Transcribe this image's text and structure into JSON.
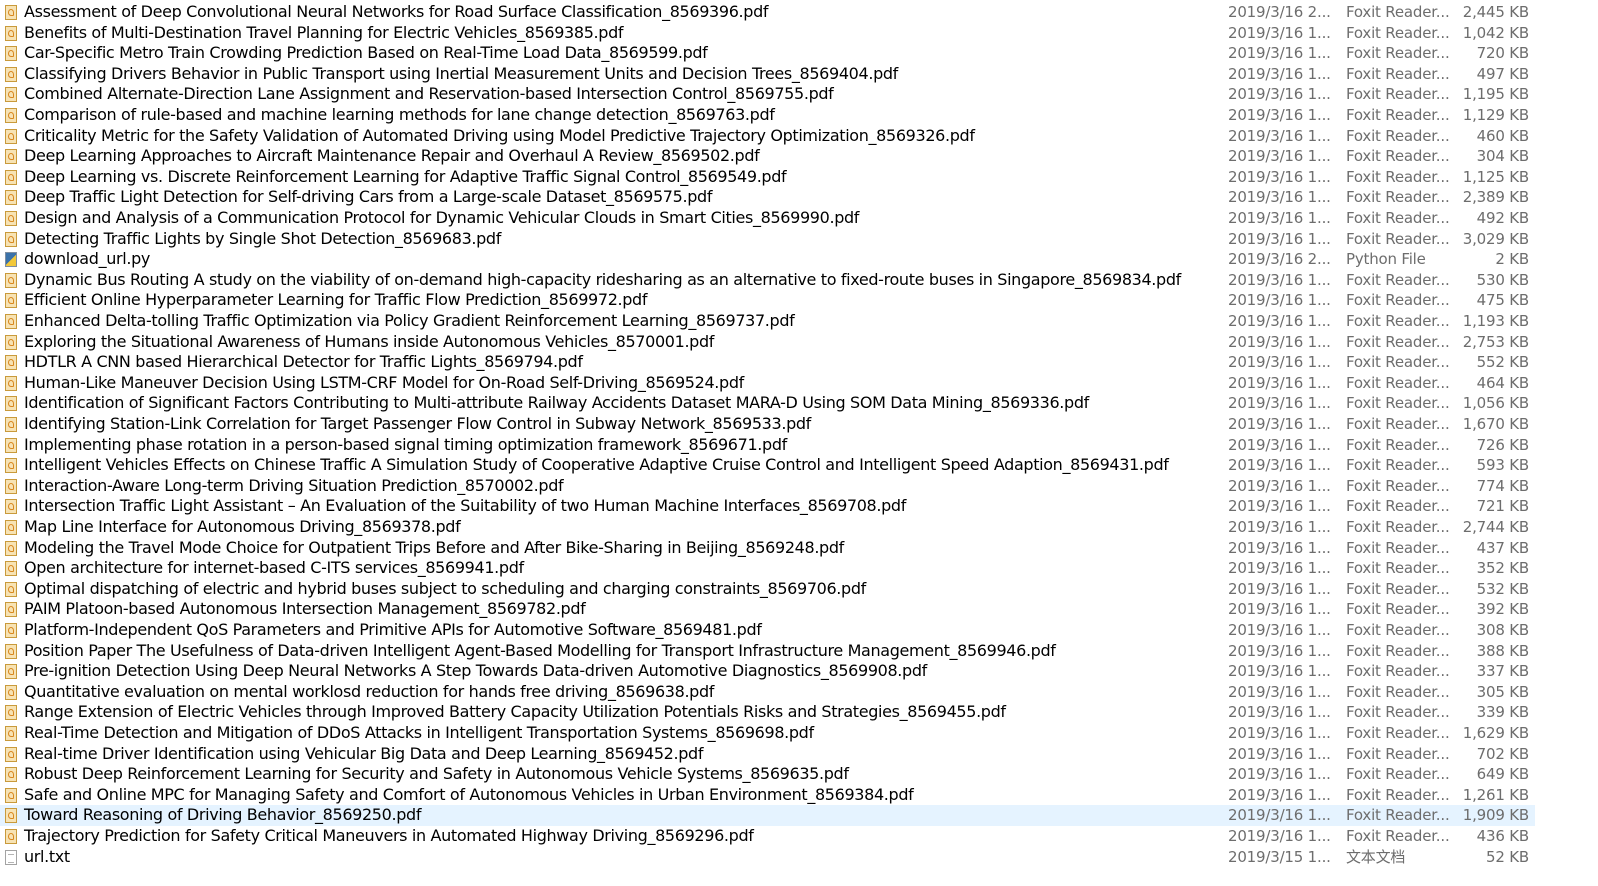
{
  "files": [
    {
      "name": "Assessment of Deep Convolutional Neural Networks for Road Surface Classification_8569396.pdf",
      "date": "2019/3/16 2...",
      "type": "Foxit Reader...",
      "size": "2,445 KB",
      "icon": "pdf-file-icon"
    },
    {
      "name": "Benefits of Multi-Destination Travel Planning for Electric Vehicles_8569385.pdf",
      "date": "2019/3/16 1...",
      "type": "Foxit Reader...",
      "size": "1,042 KB",
      "icon": "pdf-file-icon"
    },
    {
      "name": "Car-Specific Metro Train Crowding Prediction Based on Real-Time Load Data_8569599.pdf",
      "date": "2019/3/16 1...",
      "type": "Foxit Reader...",
      "size": "720 KB",
      "icon": "pdf-file-icon"
    },
    {
      "name": "Classifying Drivers Behavior in Public Transport using Inertial Measurement Units and Decision Trees_8569404.pdf",
      "date": "2019/3/16 1...",
      "type": "Foxit Reader...",
      "size": "497 KB",
      "icon": "pdf-file-icon"
    },
    {
      "name": "Combined Alternate-Direction Lane Assignment and Reservation-based Intersection Control_8569755.pdf",
      "date": "2019/3/16 1...",
      "type": "Foxit Reader...",
      "size": "1,195 KB",
      "icon": "pdf-file-icon"
    },
    {
      "name": "Comparison of rule-based and machine learning methods for lane change detection_8569763.pdf",
      "date": "2019/3/16 1...",
      "type": "Foxit Reader...",
      "size": "1,129 KB",
      "icon": "pdf-file-icon"
    },
    {
      "name": "Criticality Metric for the Safety Validation of Automated Driving using Model Predictive Trajectory Optimization_8569326.pdf",
      "date": "2019/3/16 1...",
      "type": "Foxit Reader...",
      "size": "460 KB",
      "icon": "pdf-file-icon"
    },
    {
      "name": "Deep Learning Approaches to Aircraft Maintenance Repair and Overhaul A Review_8569502.pdf",
      "date": "2019/3/16 1...",
      "type": "Foxit Reader...",
      "size": "304 KB",
      "icon": "pdf-file-icon"
    },
    {
      "name": "Deep Learning vs. Discrete Reinforcement Learning for Adaptive Traffic Signal Control_8569549.pdf",
      "date": "2019/3/16 1...",
      "type": "Foxit Reader...",
      "size": "1,125 KB",
      "icon": "pdf-file-icon"
    },
    {
      "name": "Deep Traffic Light Detection for Self-driving Cars from a Large-scale Dataset_8569575.pdf",
      "date": "2019/3/16 1...",
      "type": "Foxit Reader...",
      "size": "2,389 KB",
      "icon": "pdf-file-icon"
    },
    {
      "name": "Design and Analysis of a Communication Protocol for Dynamic Vehicular Clouds in Smart Cities_8569990.pdf",
      "date": "2019/3/16 1...",
      "type": "Foxit Reader...",
      "size": "492 KB",
      "icon": "pdf-file-icon"
    },
    {
      "name": "Detecting Traffic Lights by Single Shot Detection_8569683.pdf",
      "date": "2019/3/16 1...",
      "type": "Foxit Reader...",
      "size": "3,029 KB",
      "icon": "pdf-file-icon"
    },
    {
      "name": "download_url.py",
      "date": "2019/3/16 2...",
      "type": "Python File",
      "size": "2 KB",
      "icon": "python-file-icon"
    },
    {
      "name": "Dynamic Bus Routing A study on the viability of on-demand high-capacity ridesharing as an alternative to fixed-route buses in Singapore_8569834.pdf",
      "date": "2019/3/16 1...",
      "type": "Foxit Reader...",
      "size": "530 KB",
      "icon": "pdf-file-icon"
    },
    {
      "name": "Efficient Online Hyperparameter Learning for Traffic Flow Prediction_8569972.pdf",
      "date": "2019/3/16 1...",
      "type": "Foxit Reader...",
      "size": "475 KB",
      "icon": "pdf-file-icon"
    },
    {
      "name": "Enhanced Delta-tolling Traffic Optimization via Policy Gradient Reinforcement Learning_8569737.pdf",
      "date": "2019/3/16 1...",
      "type": "Foxit Reader...",
      "size": "1,193 KB",
      "icon": "pdf-file-icon"
    },
    {
      "name": "Exploring the Situational Awareness of Humans inside Autonomous Vehicles_8570001.pdf",
      "date": "2019/3/16 1...",
      "type": "Foxit Reader...",
      "size": "2,753 KB",
      "icon": "pdf-file-icon"
    },
    {
      "name": "HDTLR A CNN based Hierarchical Detector for Traffic Lights_8569794.pdf",
      "date": "2019/3/16 1...",
      "type": "Foxit Reader...",
      "size": "552 KB",
      "icon": "pdf-file-icon"
    },
    {
      "name": "Human-Like Maneuver Decision Using LSTM-CRF Model for On-Road Self-Driving_8569524.pdf",
      "date": "2019/3/16 1...",
      "type": "Foxit Reader...",
      "size": "464 KB",
      "icon": "pdf-file-icon"
    },
    {
      "name": "Identification of Significant Factors Contributing to Multi-attribute Railway Accidents Dataset MARA-D Using SOM Data Mining_8569336.pdf",
      "date": "2019/3/16 1...",
      "type": "Foxit Reader...",
      "size": "1,056 KB",
      "icon": "pdf-file-icon"
    },
    {
      "name": "Identifying Station-Link Correlation for Target Passenger Flow Control in Subway Network_8569533.pdf",
      "date": "2019/3/16 1...",
      "type": "Foxit Reader...",
      "size": "1,670 KB",
      "icon": "pdf-file-icon"
    },
    {
      "name": "Implementing phase rotation in a person-based signal timing optimization framework_8569671.pdf",
      "date": "2019/3/16 1...",
      "type": "Foxit Reader...",
      "size": "726 KB",
      "icon": "pdf-file-icon"
    },
    {
      "name": "Intelligent Vehicles Effects on Chinese Traffic A Simulation Study of Cooperative Adaptive Cruise Control and Intelligent Speed Adaption_8569431.pdf",
      "date": "2019/3/16 1...",
      "type": "Foxit Reader...",
      "size": "593 KB",
      "icon": "pdf-file-icon"
    },
    {
      "name": "Interaction-Aware Long-term Driving Situation Prediction_8570002.pdf",
      "date": "2019/3/16 1...",
      "type": "Foxit Reader...",
      "size": "774 KB",
      "icon": "pdf-file-icon"
    },
    {
      "name": "Intersection Traffic Light Assistant – An Evaluation of the Suitability of two Human Machine Interfaces_8569708.pdf",
      "date": "2019/3/16 1...",
      "type": "Foxit Reader...",
      "size": "721 KB",
      "icon": "pdf-file-icon"
    },
    {
      "name": "Map Line Interface for Autonomous Driving_8569378.pdf",
      "date": "2019/3/16 1...",
      "type": "Foxit Reader...",
      "size": "2,744 KB",
      "icon": "pdf-file-icon"
    },
    {
      "name": "Modeling the Travel Mode Choice for Outpatient Trips Before and After Bike-Sharing in Beijing_8569248.pdf",
      "date": "2019/3/16 1...",
      "type": "Foxit Reader...",
      "size": "437 KB",
      "icon": "pdf-file-icon"
    },
    {
      "name": "Open architecture for internet-based C-ITS services_8569941.pdf",
      "date": "2019/3/16 1...",
      "type": "Foxit Reader...",
      "size": "352 KB",
      "icon": "pdf-file-icon"
    },
    {
      "name": "Optimal dispatching of electric and hybrid buses subject to scheduling and charging constraints_8569706.pdf",
      "date": "2019/3/16 1...",
      "type": "Foxit Reader...",
      "size": "532 KB",
      "icon": "pdf-file-icon"
    },
    {
      "name": "PAIM Platoon-based Autonomous Intersection Management_8569782.pdf",
      "date": "2019/3/16 1...",
      "type": "Foxit Reader...",
      "size": "392 KB",
      "icon": "pdf-file-icon"
    },
    {
      "name": "Platform-Independent QoS Parameters and Primitive APIs for Automotive Software_8569481.pdf",
      "date": "2019/3/16 1...",
      "type": "Foxit Reader...",
      "size": "308 KB",
      "icon": "pdf-file-icon"
    },
    {
      "name": "Position Paper The Usefulness of Data-driven Intelligent Agent-Based Modelling for Transport Infrastructure Management_8569946.pdf",
      "date": "2019/3/16 1...",
      "type": "Foxit Reader...",
      "size": "388 KB",
      "icon": "pdf-file-icon"
    },
    {
      "name": "Pre-ignition Detection Using Deep Neural Networks A Step Towards Data-driven Automotive Diagnostics_8569908.pdf",
      "date": "2019/3/16 1...",
      "type": "Foxit Reader...",
      "size": "337 KB",
      "icon": "pdf-file-icon"
    },
    {
      "name": "Quantitative evaluation on mental worklosd reduction for hands free driving_8569638.pdf",
      "date": "2019/3/16 1...",
      "type": "Foxit Reader...",
      "size": "305 KB",
      "icon": "pdf-file-icon"
    },
    {
      "name": "Range Extension of Electric Vehicles through Improved Battery Capacity Utilization Potentials Risks and Strategies_8569455.pdf",
      "date": "2019/3/16 1...",
      "type": "Foxit Reader...",
      "size": "339 KB",
      "icon": "pdf-file-icon"
    },
    {
      "name": "Real-Time Detection and Mitigation of DDoS Attacks in Intelligent Transportation Systems_8569698.pdf",
      "date": "2019/3/16 1...",
      "type": "Foxit Reader...",
      "size": "1,629 KB",
      "icon": "pdf-file-icon"
    },
    {
      "name": "Real-time Driver Identification using Vehicular Big Data and Deep Learning_8569452.pdf",
      "date": "2019/3/16 1...",
      "type": "Foxit Reader...",
      "size": "702 KB",
      "icon": "pdf-file-icon"
    },
    {
      "name": "Robust Deep Reinforcement Learning for Security and Safety in Autonomous Vehicle Systems_8569635.pdf",
      "date": "2019/3/16 1...",
      "type": "Foxit Reader...",
      "size": "649 KB",
      "icon": "pdf-file-icon"
    },
    {
      "name": "Safe and Online MPC for Managing Safety and Comfort of Autonomous Vehicles in Urban Environment_8569384.pdf",
      "date": "2019/3/16 1...",
      "type": "Foxit Reader...",
      "size": "1,261 KB",
      "icon": "pdf-file-icon"
    },
    {
      "name": "Toward Reasoning of Driving Behavior_8569250.pdf",
      "date": "2019/3/16 1...",
      "type": "Foxit Reader...",
      "size": "1,909 KB",
      "icon": "pdf-file-icon",
      "selected": true
    },
    {
      "name": "Trajectory Prediction for Safety Critical Maneuvers in Automated Highway Driving_8569296.pdf",
      "date": "2019/3/16 1...",
      "type": "Foxit Reader...",
      "size": "436 KB",
      "icon": "pdf-file-icon"
    },
    {
      "name": "url.txt",
      "date": "2019/3/15 1...",
      "type": "文本文档",
      "size": "52 KB",
      "icon": "text-file-icon"
    }
  ],
  "colors": {
    "selected_row": "#e5f3ff",
    "secondary_text": "#6d6d6d"
  }
}
